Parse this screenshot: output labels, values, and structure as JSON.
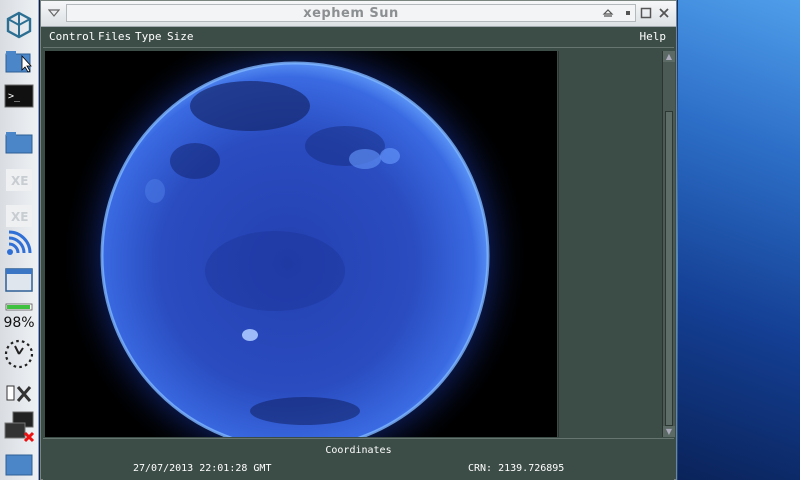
{
  "window": {
    "title": "xephem Sun"
  },
  "menu": {
    "control": "Control",
    "files": "Files",
    "type": "Type",
    "size": "Size",
    "help": "Help"
  },
  "status": {
    "coordinates_label": "Coordinates",
    "datetime": "27/07/2013 22:01:28 GMT",
    "crn": "CRN: 2139.726895"
  },
  "dock": {
    "battery_percent": "98%",
    "battery_level": 0.98
  },
  "colors": {
    "window_bg": "#3c4c47",
    "sun_blue": "#2f5fe0"
  },
  "icons": [
    "app-logo-icon",
    "folder-cursor-icon",
    "terminal-icon",
    "folder-icon",
    "xe-icon",
    "xe-icon",
    "wifi-icon",
    "window-icon",
    "battery-icon",
    "clock-icon",
    "settings-tools-icon",
    "network-disconnected-icon",
    "folder-blue-icon"
  ]
}
